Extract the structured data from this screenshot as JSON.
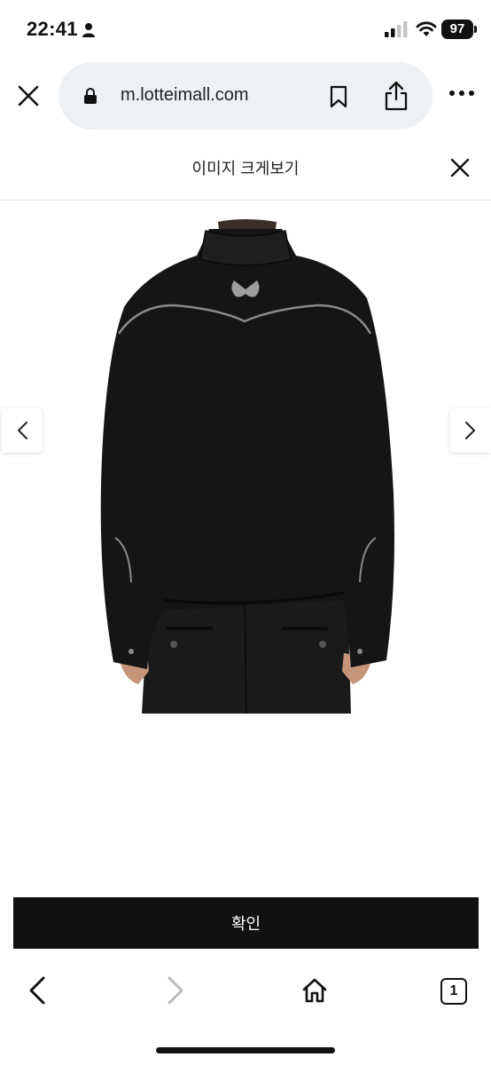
{
  "status_bar": {
    "time": "22:41",
    "battery": "97",
    "icons": [
      "person-icon",
      "signal-icon",
      "wifi-icon",
      "battery-icon"
    ]
  },
  "browser": {
    "url": "m.lotteimall.com",
    "icons": [
      "close-icon",
      "lock-icon",
      "bookmark-icon",
      "share-icon",
      "more-icon"
    ]
  },
  "modal": {
    "title": "이미지 크게보기",
    "confirm_label": "확인"
  },
  "viewer": {
    "image_subject": "black jacket with butterfly logo, back view",
    "prev_icon": "chevron-left-icon",
    "next_icon": "chevron-right-icon"
  },
  "toolbar": {
    "tab_count": "1",
    "icons": [
      "back-icon",
      "forward-icon",
      "home-icon",
      "tabs-icon"
    ]
  },
  "colors": {
    "accent": "#111111",
    "url_bar_bg": "#eef1f3",
    "forward_disabled": "#b8b8b8"
  }
}
